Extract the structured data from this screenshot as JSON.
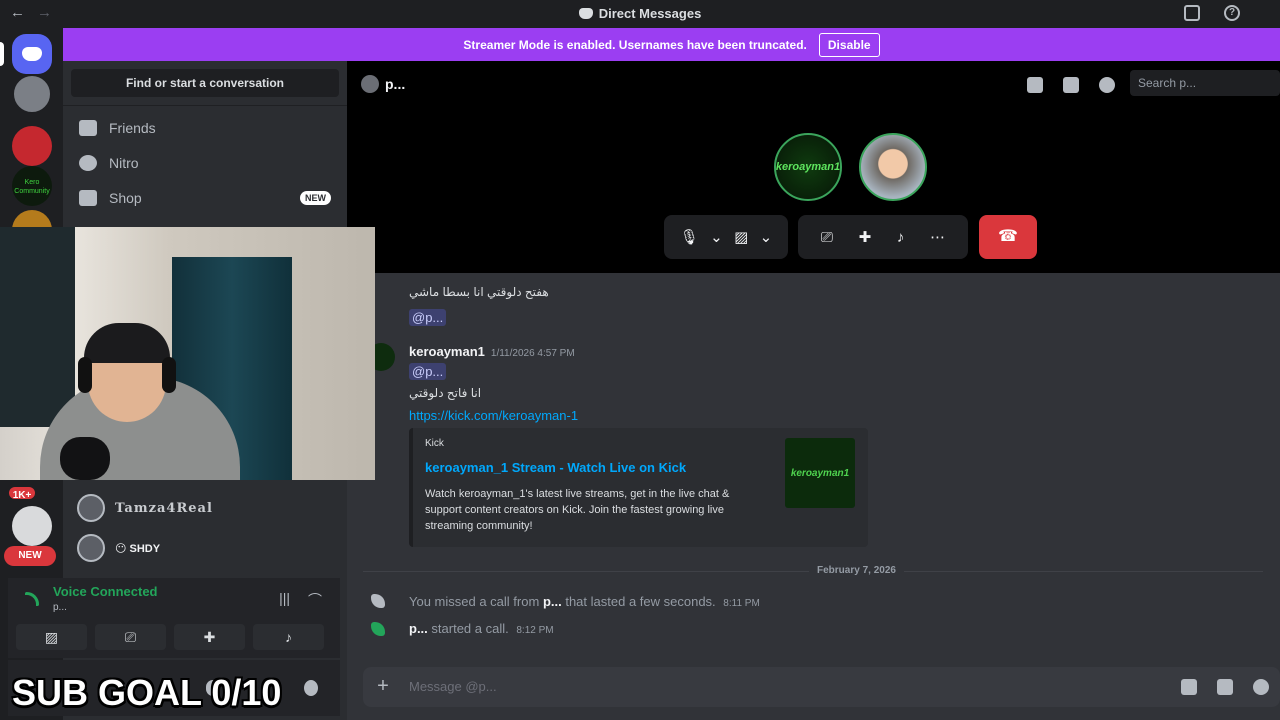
{
  "window": {
    "title": "Direct Messages",
    "back": "←",
    "forward": "→"
  },
  "banner": {
    "text": "Streamer Mode is enabled. Usernames have been truncated.",
    "button": "Disable"
  },
  "sidebar": {
    "search_label": "Find or start a conversation",
    "nav": [
      {
        "label": "Friends",
        "icon": "friends-icon"
      },
      {
        "label": "Nitro",
        "icon": "nitro-icon"
      },
      {
        "label": "Shop",
        "icon": "shop-icon",
        "badge": "NEW"
      }
    ],
    "dms": [
      {
        "name": "Tamza4Real"
      },
      {
        "name": "SHDY",
        "emoji": "😶"
      }
    ]
  },
  "rail": {
    "badge_1k": "1K+",
    "new_badge": "NEW",
    "kero_label": "Kero\nCommunity"
  },
  "voice": {
    "status": "Voice Connected",
    "sub": "p..."
  },
  "header": {
    "dm_name": "p...",
    "search_placeholder": "Search p..."
  },
  "call": {
    "avatar1_label": "keroayman1"
  },
  "messages": {
    "m1": {
      "author": "keroayman1",
      "time": "1/11/2026 4:57 PM",
      "text": "هفتح دلوقتي انا بسطا ماشي",
      "mention": "@p..."
    },
    "m2": {
      "author": "keroayman1",
      "time": "1/11/2026 4:57 PM",
      "mention": "@p...",
      "text": "انا فاتح دلوقتي",
      "link": "https://kick.com/keroayman-1"
    },
    "embed": {
      "provider": "Kick",
      "title": "keroayman_1 Stream - Watch Live on Kick",
      "description": "Watch keroayman_1's latest live streams, get in the live chat & support content creators on Kick. Join the fastest growing live streaming community!",
      "thumb_label": "keroayman1"
    },
    "date_divider": "February 7, 2026",
    "sys1": {
      "pre": "You missed a call from",
      "name": "p...",
      "post": "that lasted a few seconds.",
      "time": "8:11 PM"
    },
    "sys2": {
      "name": "p...",
      "post": "started a call.",
      "time": "8:12 PM"
    }
  },
  "composer": {
    "placeholder": "Message @p..."
  },
  "overlay": {
    "sub_goal": "SUB GOAL 0/10"
  },
  "colors": {
    "accent": "#5865f2",
    "streamer_banner": "#9b3ef2",
    "voice_green": "#23a55a",
    "hangup": "#da373c",
    "link": "#00a8fc"
  }
}
